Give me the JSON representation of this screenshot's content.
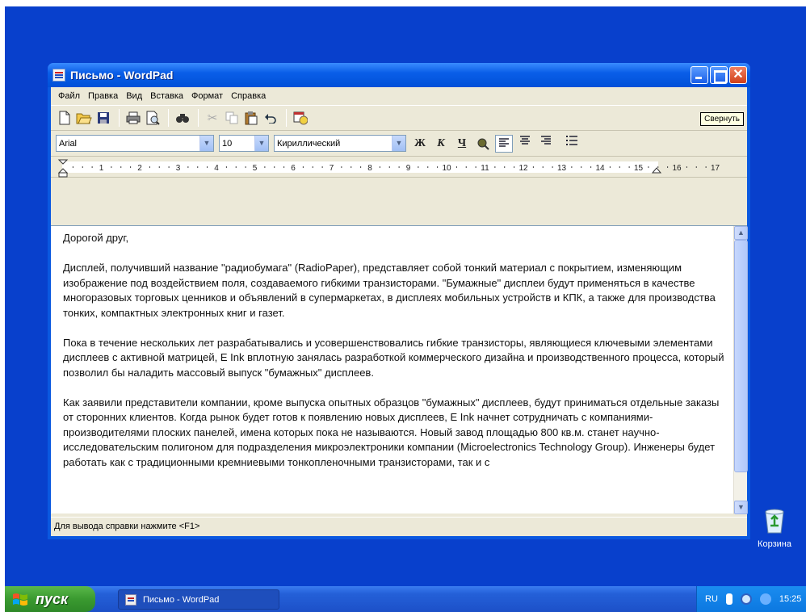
{
  "window": {
    "title": "Письмо - WordPad"
  },
  "menu": [
    "Файл",
    "Правка",
    "Вид",
    "Вставка",
    "Формат",
    "Справка"
  ],
  "tooltip": "Свернуть",
  "toolbar_icons": [
    "new-icon",
    "open-icon",
    "save-icon",
    "print-icon",
    "print-preview-icon",
    "find-icon",
    "cut-icon",
    "copy-icon",
    "paste-icon",
    "undo-icon",
    "datetime-icon"
  ],
  "format": {
    "font": "Arial",
    "size": "10",
    "script": "Кириллический",
    "bold": "Ж",
    "italic": "К",
    "underline": "Ч"
  },
  "ruler": {
    "numbers": [
      "1",
      "2",
      "3",
      "4",
      "5",
      "6",
      "7",
      "8",
      "9",
      "10",
      "11",
      "12",
      "13",
      "14",
      "15",
      "16",
      "17"
    ]
  },
  "document": {
    "paragraphs": [
      "Дорогой друг,",
      "Дисплей, получивший название \"радиобумага\" (RadioPaper), представляет собой тонкий материал с покрытием, изменяющим изображение под воздействием поля, создаваемого гибкими транзисторами. \"Бумажные\" дисплеи будут применяться в качестве многоразовых торговых ценников и объявлений в супермаркетах, в дисплеях мобильных устройств и КПК, а также для производства тонких, компактных электронных книг и газет.",
      "Пока в течение нескольких лет разрабатывались и усовершенствовались гибкие транзисторы, являющиеся ключевыми элементами дисплеев с активной матрицей, E Ink вплотную занялась разработкой коммерческого дизайна и производственного процесса, который позволил бы наладить массовый выпуск \"бумажных\" дисплеев.",
      "Как заявили представители компании, кроме выпуска опытных образцов \"бумажных\" дисплеев, будут приниматься отдельные заказы от сторонних клиентов. Когда рынок будет готов к появлению новых дисплеев, E Ink начнет сотрудничать с компаниями-производителями плоских панелей, имена которых пока не называются. Новый завод площадью 800 кв.м. станет научно-исследовательским полигоном для подразделения микроэлектроники компании (Microelectronics Technology Group). Инженеры будет работать как с традиционными кремниевыми тонкопленочными транзисторами, так и с"
    ]
  },
  "status": "Для вывода справки нажмите <F1>",
  "desktop": {
    "recycle_label": "Корзина"
  },
  "taskbar": {
    "start_label": "пуск",
    "task_label": "Письмо - WordPad",
    "lang": "RU",
    "clock": "15:25"
  }
}
